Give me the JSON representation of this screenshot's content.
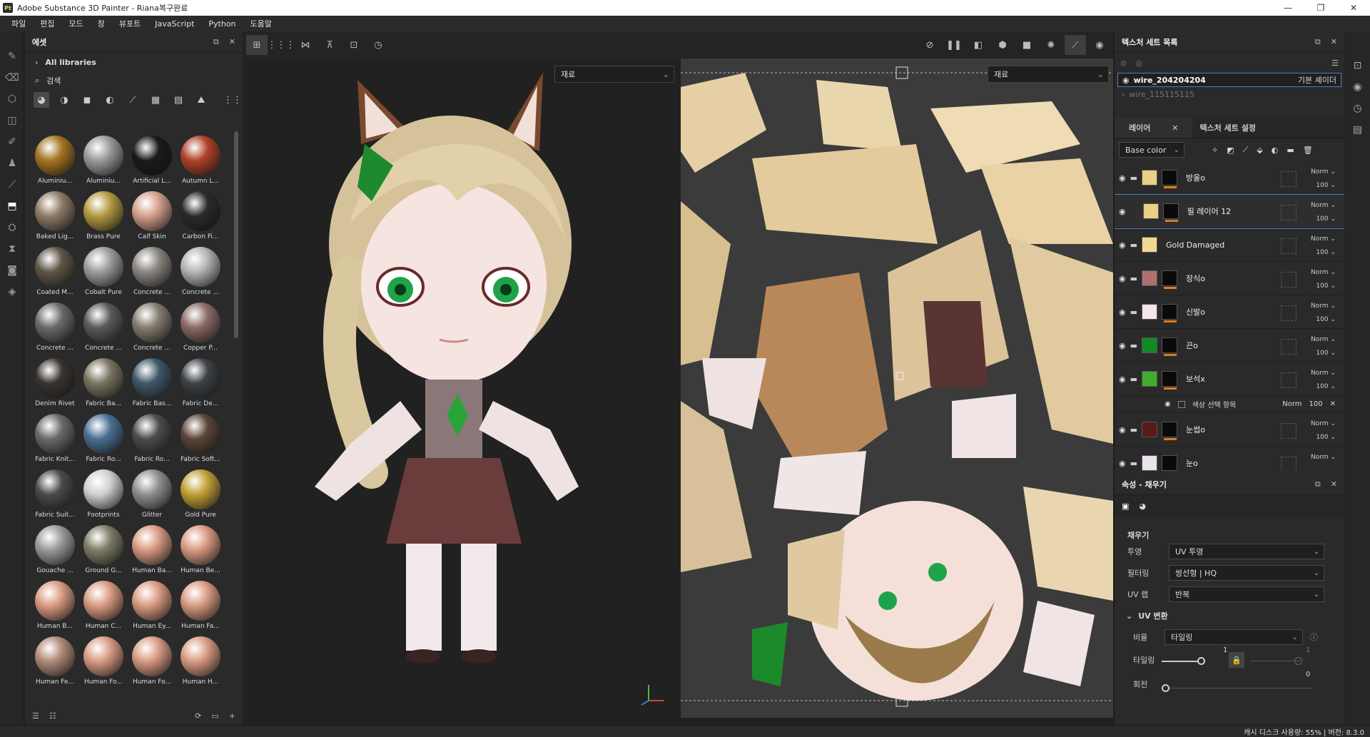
{
  "window": {
    "title": "Adobe Substance 3D Painter - Riana복구완료",
    "logo": "Pt"
  },
  "menu": [
    "파일",
    "편집",
    "모드",
    "창",
    "뷰포트",
    "JavaScript",
    "Python",
    "도움말"
  ],
  "assets": {
    "title": "에셋",
    "library": "All libraries",
    "search_placeholder": "검색",
    "items": [
      {
        "label": "Aluminiu...",
        "c": "#a57422"
      },
      {
        "label": "Aluminiu...",
        "c": "#9a9a9a"
      },
      {
        "label": "Artificial L...",
        "c": "#1a1a1a"
      },
      {
        "label": "Autumn L...",
        "c": "#b0412a"
      },
      {
        "label": "Baked Lig...",
        "c": "#8e7a66"
      },
      {
        "label": "Brass Pure",
        "c": "#b39a40"
      },
      {
        "label": "Calf Skin",
        "c": "#d4a08c"
      },
      {
        "label": "Carbon Fi...",
        "c": "#2a2a2a"
      },
      {
        "label": "Coated M...",
        "c": "#5e5545"
      },
      {
        "label": "Cobalt Pure",
        "c": "#9c9c9c"
      },
      {
        "label": "Concrete ...",
        "c": "#8a8680"
      },
      {
        "label": "Concrete ...",
        "c": "#b5b5b5"
      },
      {
        "label": "Concrete ...",
        "c": "#6a6a6a"
      },
      {
        "label": "Concrete ...",
        "c": "#5a5a5a"
      },
      {
        "label": "Concrete ...",
        "c": "#857c70"
      },
      {
        "label": "Copper P...",
        "c": "#8a6a66"
      },
      {
        "label": "Denim Rivet",
        "c": "#3a3430"
      },
      {
        "label": "Fabric Ba...",
        "c": "#7a7460"
      },
      {
        "label": "Fabric Bas...",
        "c": "#3f5868"
      },
      {
        "label": "Fabric De...",
        "c": "#3e4246"
      },
      {
        "label": "Fabric Knit...",
        "c": "#6a6a6a"
      },
      {
        "label": "Fabric Ro...",
        "c": "#4a6f92"
      },
      {
        "label": "Fabric Ro...",
        "c": "#4c4c4c"
      },
      {
        "label": "Fabric Soft...",
        "c": "#5a4538"
      },
      {
        "label": "Fabric Suit...",
        "c": "#4a4a4a"
      },
      {
        "label": "Footprints",
        "c": "#d0d0d0"
      },
      {
        "label": "Glitter",
        "c": "#8f8f8f"
      },
      {
        "label": "Gold Pure",
        "c": "#c0a035"
      },
      {
        "label": "Gouache ...",
        "c": "#9a9a9a"
      },
      {
        "label": "Ground G...",
        "c": "#7f7c68"
      },
      {
        "label": "Human Ba...",
        "c": "#d99b82"
      },
      {
        "label": "Human Be...",
        "c": "#d99b82"
      },
      {
        "label": "Human B...",
        "c": "#d99b82"
      },
      {
        "label": "Human C...",
        "c": "#d99b82"
      },
      {
        "label": "Human Ey...",
        "c": "#d99b82"
      },
      {
        "label": "Human Fa...",
        "c": "#d99b82"
      },
      {
        "label": "Human Fe...",
        "c": "#b08a78"
      },
      {
        "label": "Human Fo...",
        "c": "#d99b82"
      },
      {
        "label": "Human Fo...",
        "c": "#d99b82"
      },
      {
        "label": "Human H...",
        "c": "#d99b82"
      }
    ]
  },
  "viewport": {
    "left_select": "재료",
    "right_select": "재료"
  },
  "texture_sets": {
    "title": "텍스처 세트 목록",
    "items": [
      {
        "name": "wire_204204204",
        "shader": "기본 셰이더"
      },
      {
        "name": "wire_115115115",
        "shader": ""
      }
    ]
  },
  "layers": {
    "tab_layers": "레이어",
    "tab_settings": "텍스처 세트 설정",
    "channel": "Base color",
    "items": [
      {
        "name": "방울o",
        "color": "#e8d084",
        "blend": "Norm",
        "opacity": "100",
        "folder": true
      },
      {
        "name": "필 레이어 12",
        "color": "#e8d084",
        "blend": "Norm",
        "opacity": "100",
        "folder": false
      },
      {
        "name": "Gold Damaged",
        "color": "#f0d890",
        "blend": "Norm",
        "opacity": "100",
        "folder": true
      },
      {
        "name": "장식o",
        "color": "#b07070",
        "blend": "Norm",
        "opacity": "100",
        "folder": true
      },
      {
        "name": "신발o",
        "color": "#f5e6ea",
        "blend": "Norm",
        "opacity": "100",
        "folder": true
      },
      {
        "name": "끈o",
        "color": "#118a23",
        "blend": "Norm",
        "opacity": "100",
        "folder": true
      },
      {
        "name": "보석x",
        "color": "#3fae2c",
        "blend": "Norm",
        "opacity": "100",
        "folder": true
      }
    ],
    "sub_effect": {
      "name": "색상 선택 항목",
      "blend": "Norm",
      "opacity": "100"
    },
    "items2": [
      {
        "name": "눈썹o",
        "color": "#5a1a1a",
        "blend": "Norm",
        "opacity": "100",
        "folder": true
      },
      {
        "name": "눈o",
        "color": "#ece2ee",
        "blend": "Norm",
        "opacity": "",
        "folder": true
      }
    ]
  },
  "properties": {
    "title": "속성 - 채우기",
    "section": "채우기",
    "rows": [
      {
        "k": "투영",
        "v": "UV 투영"
      },
      {
        "k": "필터링",
        "v": "쌍선형 | HQ"
      },
      {
        "k": "UV 랩",
        "v": "반복"
      }
    ],
    "uv_section": "UV 변환",
    "ratio_label": "비율",
    "ratio_value": "타일링",
    "tiling_label": "타일링",
    "tiling_value": "1",
    "tiling_value2": "1",
    "rotate_label": "회전",
    "rotate_value": "0"
  },
  "status": "캐시 디스크 사용량:   55% | 버전: 8.3.0"
}
